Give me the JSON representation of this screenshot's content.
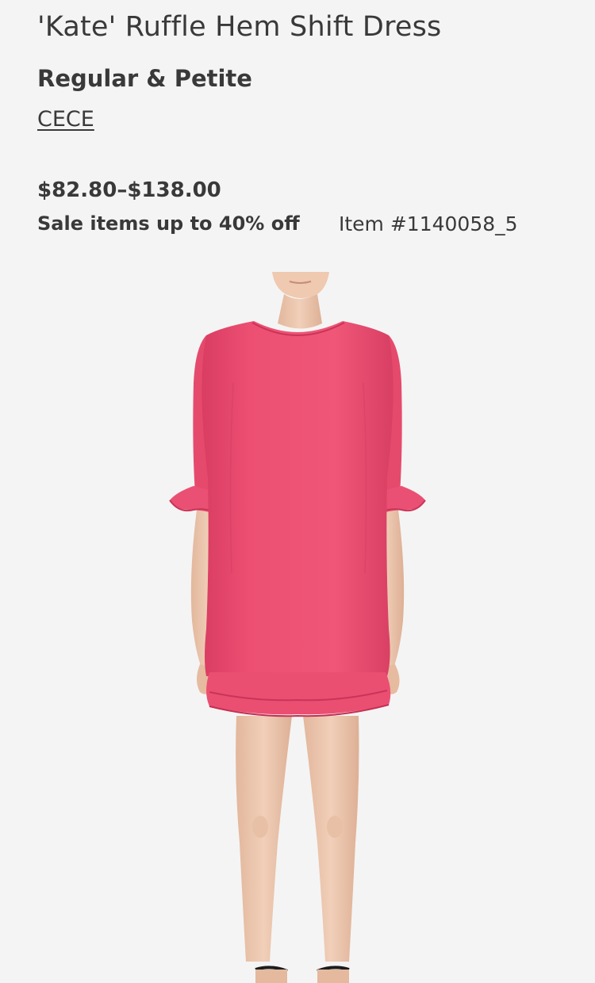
{
  "product": {
    "title": "'Kate' Ruffle Hem Shift Dress",
    "fit": "Regular & Petite",
    "brand": "CECE",
    "price_range": "$82.80–$138.00",
    "sale_note": "Sale items up to 40% off",
    "item_number": "Item #1140058_5"
  },
  "image": {
    "subject": "model wearing pink ruffle hem shift dress",
    "dress_color": "#ec4f72",
    "skin_color": "#efcbb4",
    "background_color": "#f4f4f4"
  }
}
